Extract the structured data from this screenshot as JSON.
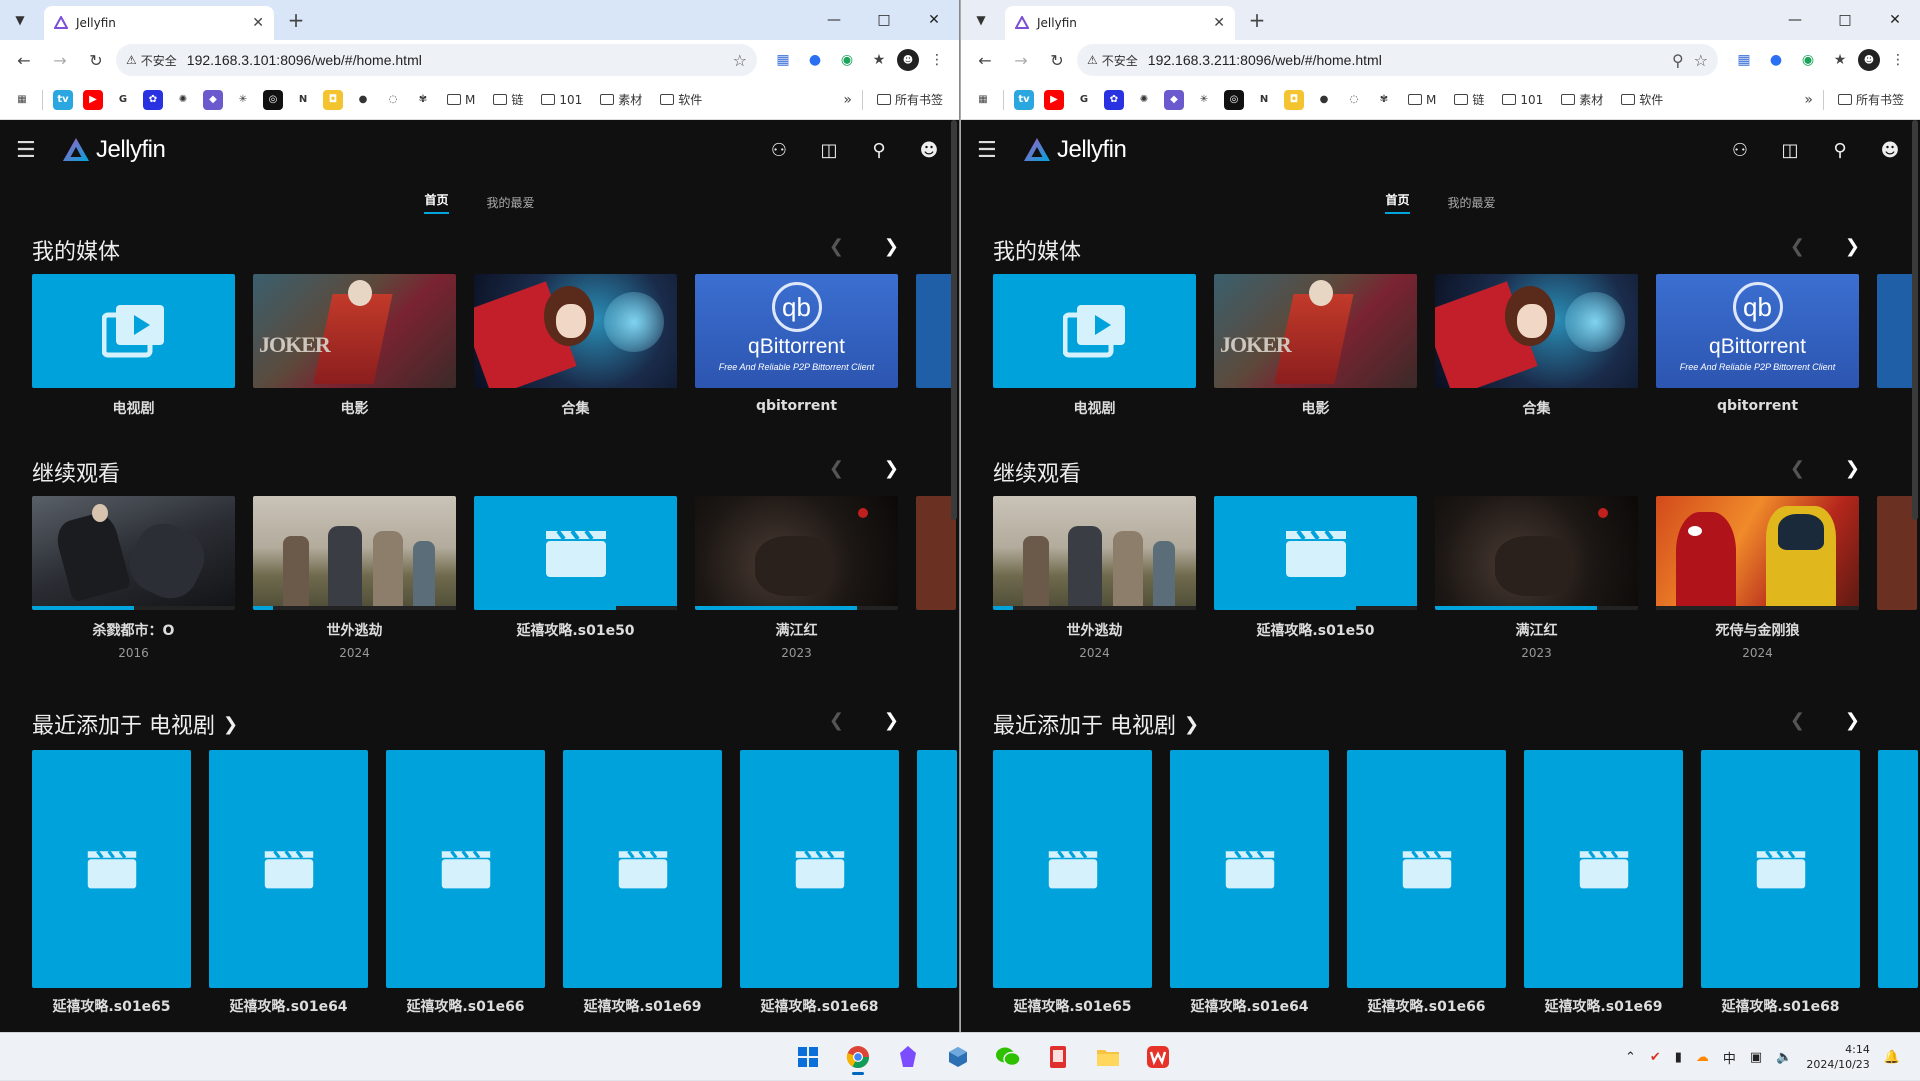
{
  "windows": [
    {
      "tab_title": "Jellyfin",
      "security_label": "不安全",
      "url": "192.168.3.101:8096/web/#/home.html",
      "my_media_items": [
        {
          "label": "电视剧",
          "art": "tv"
        },
        {
          "label": "电影",
          "art": "joker"
        },
        {
          "label": "合集",
          "art": "anime"
        },
        {
          "label": "qbitorrent",
          "art": "qbt"
        }
      ],
      "continue_items": [
        {
          "title": "杀戮都市：O",
          "year": "2016",
          "art": "gantz",
          "progress": 0.5
        },
        {
          "title": "世外逃劫",
          "year": "2024",
          "art": "field",
          "progress": 0.1
        },
        {
          "title": "延禧攻略.s01e50",
          "year": "",
          "art": "placeholder",
          "progress": 0.7
        },
        {
          "title": "满江红",
          "year": "2023",
          "art": "dark",
          "progress": 0.8
        }
      ],
      "recent_items": [
        "延禧攻略.s01e65",
        "延禧攻略.s01e64",
        "延禧攻略.s01e66",
        "延禧攻略.s01e69",
        "延禧攻略.s01e68"
      ]
    },
    {
      "tab_title": "Jellyfin",
      "security_label": "不安全",
      "url": "192.168.3.211:8096/web/#/home.html",
      "my_media_items": [
        {
          "label": "电视剧",
          "art": "tv"
        },
        {
          "label": "电影",
          "art": "joker"
        },
        {
          "label": "合集",
          "art": "anime"
        },
        {
          "label": "qbitorrent",
          "art": "qbt"
        }
      ],
      "continue_items": [
        {
          "title": "世外逃劫",
          "year": "2024",
          "art": "field",
          "progress": 0.1
        },
        {
          "title": "延禧攻略.s01e50",
          "year": "",
          "art": "placeholder",
          "progress": 0.7
        },
        {
          "title": "满江红",
          "year": "2023",
          "art": "dark",
          "progress": 0.8
        },
        {
          "title": "死侍与金刚狼",
          "year": "2024",
          "art": "deadpool",
          "progress": 0.0
        }
      ],
      "recent_items": [
        "延禧攻略.s01e65",
        "延禧攻略.s01e64",
        "延禧攻略.s01e66",
        "延禧攻略.s01e69",
        "延禧攻略.s01e68"
      ]
    }
  ],
  "bookmarks": {
    "folders": [
      "M",
      "链",
      "101",
      "素材",
      "软件"
    ],
    "all_bookmarks": "所有书签",
    "more": "»"
  },
  "jellyfin": {
    "brand": "Jellyfin",
    "tab_home": "首页",
    "tab_favorites": "我的最爱",
    "section_my_media": "我的媒体",
    "section_continue": "继续观看",
    "section_recent": "最近添加于 电视剧",
    "qbt_logo_letters": "qb",
    "qbt_name": "qBittorrent",
    "qbt_tagline": "Free And Reliable P2P Bittorrent Client",
    "joker_text": "JOKER"
  },
  "taskbar": {
    "time": "4:14",
    "date": "2024/10/23"
  },
  "colors": {
    "accent": "#00a4dc",
    "bg": "#101010"
  }
}
